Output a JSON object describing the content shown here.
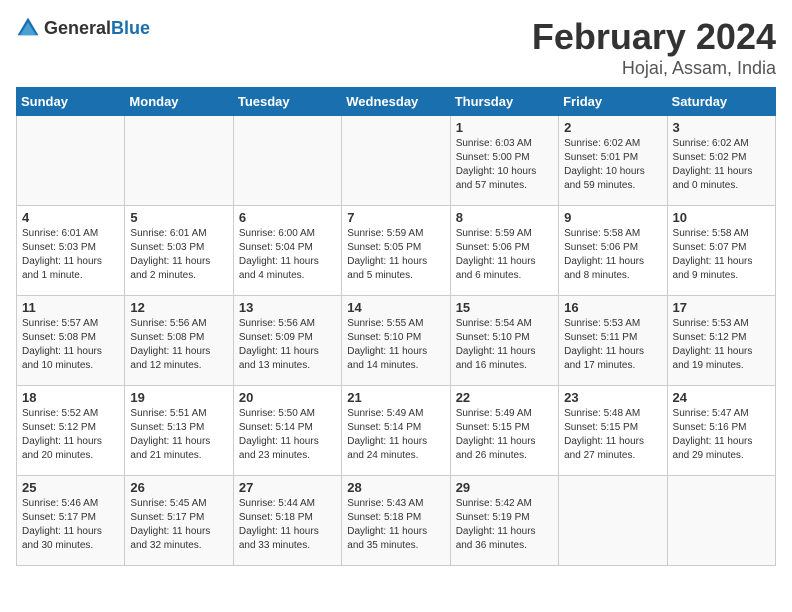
{
  "header": {
    "logo_general": "General",
    "logo_blue": "Blue",
    "title": "February 2024",
    "subtitle": "Hojai, Assam, India"
  },
  "days_of_week": [
    "Sunday",
    "Monday",
    "Tuesday",
    "Wednesday",
    "Thursday",
    "Friday",
    "Saturday"
  ],
  "weeks": [
    [
      {
        "day": "",
        "info": ""
      },
      {
        "day": "",
        "info": ""
      },
      {
        "day": "",
        "info": ""
      },
      {
        "day": "",
        "info": ""
      },
      {
        "day": "1",
        "info": "Sunrise: 6:03 AM\nSunset: 5:00 PM\nDaylight: 10 hours\nand 57 minutes."
      },
      {
        "day": "2",
        "info": "Sunrise: 6:02 AM\nSunset: 5:01 PM\nDaylight: 10 hours\nand 59 minutes."
      },
      {
        "day": "3",
        "info": "Sunrise: 6:02 AM\nSunset: 5:02 PM\nDaylight: 11 hours\nand 0 minutes."
      }
    ],
    [
      {
        "day": "4",
        "info": "Sunrise: 6:01 AM\nSunset: 5:03 PM\nDaylight: 11 hours\nand 1 minute."
      },
      {
        "day": "5",
        "info": "Sunrise: 6:01 AM\nSunset: 5:03 PM\nDaylight: 11 hours\nand 2 minutes."
      },
      {
        "day": "6",
        "info": "Sunrise: 6:00 AM\nSunset: 5:04 PM\nDaylight: 11 hours\nand 4 minutes."
      },
      {
        "day": "7",
        "info": "Sunrise: 5:59 AM\nSunset: 5:05 PM\nDaylight: 11 hours\nand 5 minutes."
      },
      {
        "day": "8",
        "info": "Sunrise: 5:59 AM\nSunset: 5:06 PM\nDaylight: 11 hours\nand 6 minutes."
      },
      {
        "day": "9",
        "info": "Sunrise: 5:58 AM\nSunset: 5:06 PM\nDaylight: 11 hours\nand 8 minutes."
      },
      {
        "day": "10",
        "info": "Sunrise: 5:58 AM\nSunset: 5:07 PM\nDaylight: 11 hours\nand 9 minutes."
      }
    ],
    [
      {
        "day": "11",
        "info": "Sunrise: 5:57 AM\nSunset: 5:08 PM\nDaylight: 11 hours\nand 10 minutes."
      },
      {
        "day": "12",
        "info": "Sunrise: 5:56 AM\nSunset: 5:08 PM\nDaylight: 11 hours\nand 12 minutes."
      },
      {
        "day": "13",
        "info": "Sunrise: 5:56 AM\nSunset: 5:09 PM\nDaylight: 11 hours\nand 13 minutes."
      },
      {
        "day": "14",
        "info": "Sunrise: 5:55 AM\nSunset: 5:10 PM\nDaylight: 11 hours\nand 14 minutes."
      },
      {
        "day": "15",
        "info": "Sunrise: 5:54 AM\nSunset: 5:10 PM\nDaylight: 11 hours\nand 16 minutes."
      },
      {
        "day": "16",
        "info": "Sunrise: 5:53 AM\nSunset: 5:11 PM\nDaylight: 11 hours\nand 17 minutes."
      },
      {
        "day": "17",
        "info": "Sunrise: 5:53 AM\nSunset: 5:12 PM\nDaylight: 11 hours\nand 19 minutes."
      }
    ],
    [
      {
        "day": "18",
        "info": "Sunrise: 5:52 AM\nSunset: 5:12 PM\nDaylight: 11 hours\nand 20 minutes."
      },
      {
        "day": "19",
        "info": "Sunrise: 5:51 AM\nSunset: 5:13 PM\nDaylight: 11 hours\nand 21 minutes."
      },
      {
        "day": "20",
        "info": "Sunrise: 5:50 AM\nSunset: 5:14 PM\nDaylight: 11 hours\nand 23 minutes."
      },
      {
        "day": "21",
        "info": "Sunrise: 5:49 AM\nSunset: 5:14 PM\nDaylight: 11 hours\nand 24 minutes."
      },
      {
        "day": "22",
        "info": "Sunrise: 5:49 AM\nSunset: 5:15 PM\nDaylight: 11 hours\nand 26 minutes."
      },
      {
        "day": "23",
        "info": "Sunrise: 5:48 AM\nSunset: 5:15 PM\nDaylight: 11 hours\nand 27 minutes."
      },
      {
        "day": "24",
        "info": "Sunrise: 5:47 AM\nSunset: 5:16 PM\nDaylight: 11 hours\nand 29 minutes."
      }
    ],
    [
      {
        "day": "25",
        "info": "Sunrise: 5:46 AM\nSunset: 5:17 PM\nDaylight: 11 hours\nand 30 minutes."
      },
      {
        "day": "26",
        "info": "Sunrise: 5:45 AM\nSunset: 5:17 PM\nDaylight: 11 hours\nand 32 minutes."
      },
      {
        "day": "27",
        "info": "Sunrise: 5:44 AM\nSunset: 5:18 PM\nDaylight: 11 hours\nand 33 minutes."
      },
      {
        "day": "28",
        "info": "Sunrise: 5:43 AM\nSunset: 5:18 PM\nDaylight: 11 hours\nand 35 minutes."
      },
      {
        "day": "29",
        "info": "Sunrise: 5:42 AM\nSunset: 5:19 PM\nDaylight: 11 hours\nand 36 minutes."
      },
      {
        "day": "",
        "info": ""
      },
      {
        "day": "",
        "info": ""
      }
    ]
  ]
}
